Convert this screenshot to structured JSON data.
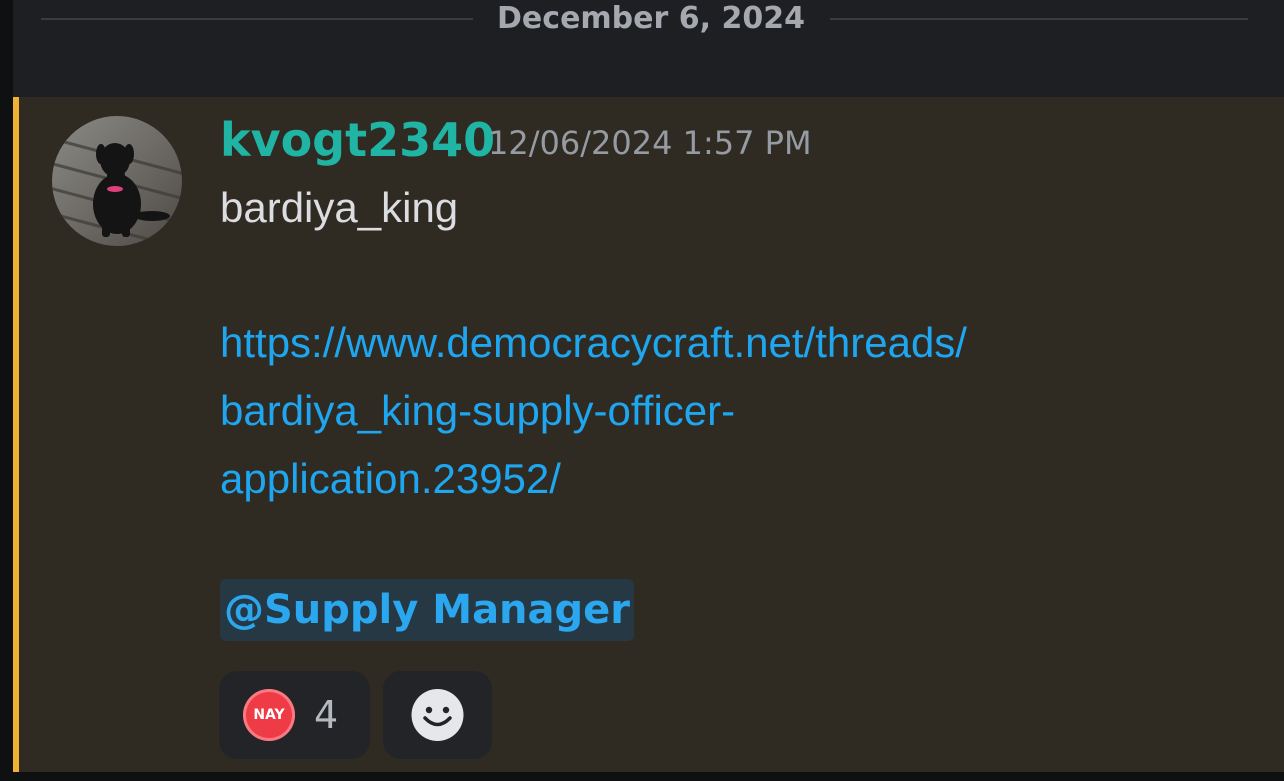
{
  "date_divider": "December 6, 2024",
  "message": {
    "username": "kvogt2340",
    "timestamp": "12/06/2024 1:57 PM",
    "text": "bardiya_king",
    "link": {
      "line1": "https://www.democracycraft.net/threads/",
      "line2": "bardiya_king-supply-officer-",
      "line3": "application.23952/"
    },
    "mention": "@Supply Manager",
    "reactions": [
      {
        "emoji_label": "NAY",
        "count": "4"
      }
    ],
    "add_reaction_icon": "smiley-icon"
  },
  "colors": {
    "background": "#1e1f22",
    "highlight_background": "#2f2b23",
    "highlight_bar": "#f0b232",
    "username": "#1fb4a4",
    "link": "#1ea6f0",
    "mention": "#2aa7ee",
    "nay": "#ee3b45"
  }
}
